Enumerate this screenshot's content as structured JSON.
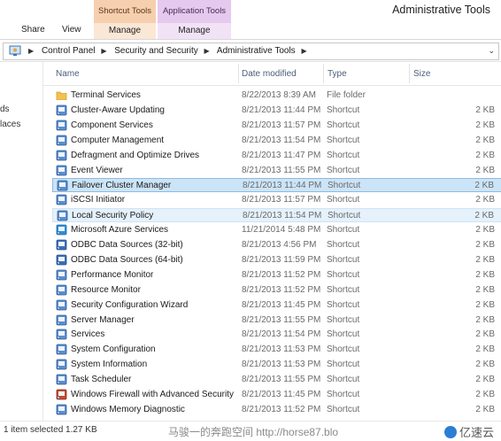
{
  "window": {
    "title": "Administrative Tools",
    "context_tabs": {
      "shortcut_tools": "Shortcut Tools",
      "application_tools": "Application Tools"
    }
  },
  "ribbon": {
    "share": "Share",
    "view": "View",
    "manage_shortcut": "Manage",
    "manage_application": "Manage"
  },
  "address": {
    "crumbs": [
      "Control Panel",
      "Security and Security",
      "Administrative Tools"
    ]
  },
  "navpane": {
    "items": [
      "ds",
      "laces"
    ]
  },
  "columns": {
    "name": "Name",
    "date": "Date modified",
    "type": "Type",
    "size": "Size"
  },
  "files": [
    {
      "name": "Terminal Services",
      "date": "8/22/2013 8:39 AM",
      "type": "File folder",
      "size": "",
      "icon": "folder-icon"
    },
    {
      "name": "Cluster-Aware Updating",
      "date": "8/21/2013 11:44 PM",
      "type": "Shortcut",
      "size": "2 KB",
      "icon": "cluster-updating-icon"
    },
    {
      "name": "Component Services",
      "date": "8/21/2013 11:57 PM",
      "type": "Shortcut",
      "size": "2 KB",
      "icon": "component-services-icon"
    },
    {
      "name": "Computer Management",
      "date": "8/21/2013 11:54 PM",
      "type": "Shortcut",
      "size": "2 KB",
      "icon": "computer-management-icon"
    },
    {
      "name": "Defragment and Optimize Drives",
      "date": "8/21/2013 11:47 PM",
      "type": "Shortcut",
      "size": "2 KB",
      "icon": "defrag-icon"
    },
    {
      "name": "Event Viewer",
      "date": "8/21/2013 11:55 PM",
      "type": "Shortcut",
      "size": "2 KB",
      "icon": "event-viewer-icon"
    },
    {
      "name": "Failover Cluster Manager",
      "date": "8/21/2013 11:44 PM",
      "type": "Shortcut",
      "size": "2 KB",
      "icon": "failover-cluster-icon"
    },
    {
      "name": "iSCSI Initiator",
      "date": "8/21/2013 11:57 PM",
      "type": "Shortcut",
      "size": "2 KB",
      "icon": "iscsi-icon"
    },
    {
      "name": "Local Security Policy",
      "date": "8/21/2013 11:54 PM",
      "type": "Shortcut",
      "size": "2 KB",
      "icon": "security-policy-icon"
    },
    {
      "name": "Microsoft Azure Services",
      "date": "11/21/2014 5:48 PM",
      "type": "Shortcut",
      "size": "2 KB",
      "icon": "azure-icon"
    },
    {
      "name": "ODBC Data Sources (32-bit)",
      "date": "8/21/2013 4:56 PM",
      "type": "Shortcut",
      "size": "2 KB",
      "icon": "odbc-icon"
    },
    {
      "name": "ODBC Data Sources (64-bit)",
      "date": "8/21/2013 11:59 PM",
      "type": "Shortcut",
      "size": "2 KB",
      "icon": "odbc-icon"
    },
    {
      "name": "Performance Monitor",
      "date": "8/21/2013 11:52 PM",
      "type": "Shortcut",
      "size": "2 KB",
      "icon": "performance-monitor-icon"
    },
    {
      "name": "Resource Monitor",
      "date": "8/21/2013 11:52 PM",
      "type": "Shortcut",
      "size": "2 KB",
      "icon": "resource-monitor-icon"
    },
    {
      "name": "Security Configuration Wizard",
      "date": "8/21/2013 11:45 PM",
      "type": "Shortcut",
      "size": "2 KB",
      "icon": "security-wizard-icon"
    },
    {
      "name": "Server Manager",
      "date": "8/21/2013 11:55 PM",
      "type": "Shortcut",
      "size": "2 KB",
      "icon": "server-manager-icon"
    },
    {
      "name": "Services",
      "date": "8/21/2013 11:54 PM",
      "type": "Shortcut",
      "size": "2 KB",
      "icon": "services-icon"
    },
    {
      "name": "System Configuration",
      "date": "8/21/2013 11:53 PM",
      "type": "Shortcut",
      "size": "2 KB",
      "icon": "system-configuration-icon"
    },
    {
      "name": "System Information",
      "date": "8/21/2013 11:53 PM",
      "type": "Shortcut",
      "size": "2 KB",
      "icon": "system-information-icon"
    },
    {
      "name": "Task Scheduler",
      "date": "8/21/2013 11:55 PM",
      "type": "Shortcut",
      "size": "2 KB",
      "icon": "task-scheduler-icon"
    },
    {
      "name": "Windows Firewall with Advanced Security",
      "date": "8/21/2013 11:45 PM",
      "type": "Shortcut",
      "size": "2 KB",
      "icon": "firewall-icon"
    },
    {
      "name": "Windows Memory Diagnostic",
      "date": "8/21/2013 11:52 PM",
      "type": "Shortcut",
      "size": "2 KB",
      "icon": "memory-diagnostic-icon"
    }
  ],
  "selected_row": "Failover Cluster Manager",
  "hover_row": "Local Security Policy",
  "status": {
    "selected": "1 item selected  1.27 KB"
  },
  "watermark": "马骏一的奔跑空间 http://horse87.blo",
  "brand": "亿速云",
  "colors": {
    "selected_bg": "#cce4f7",
    "shortcut_tab": "#f6cfae",
    "application_tab": "#e6c9ee"
  }
}
